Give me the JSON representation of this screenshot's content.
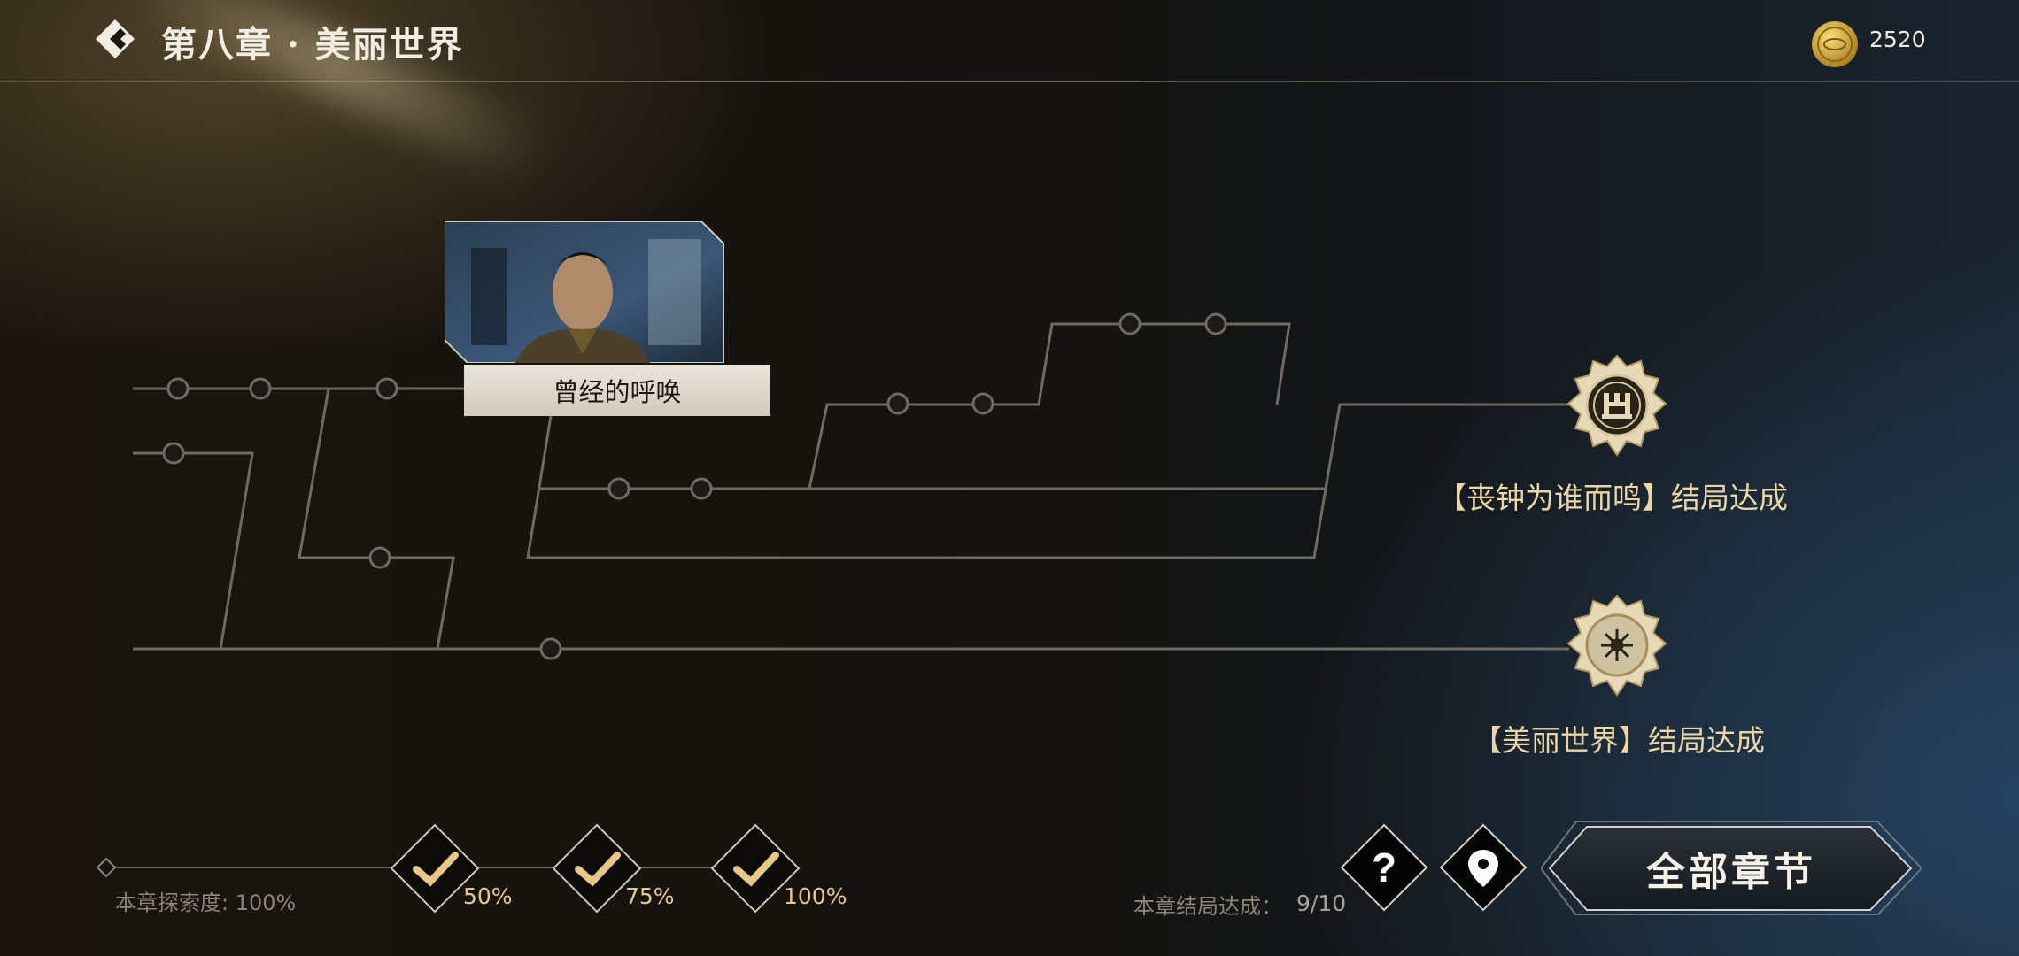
{
  "header": {
    "title": "第八章 · 美丽世界",
    "coins": "2520"
  },
  "story_map": {
    "current_node_label": "曾经的呼唤"
  },
  "endings": [
    {
      "label": "【丧钟为谁而鸣】结局达成",
      "icon": "tower-badge-icon"
    },
    {
      "label": "【美丽世界】结局达成",
      "icon": "flower-badge-icon"
    }
  ],
  "footer": {
    "explore_label": "本章探索度:",
    "explore_value": "100%",
    "milestones": [
      "50%",
      "75%",
      "100%"
    ],
    "endings_label": "本章结局达成：",
    "endings_count": "9/10",
    "all_chapters": "全部章节"
  },
  "colors": {
    "accent_gold": "#e8c889",
    "line": "#6e6a64"
  }
}
